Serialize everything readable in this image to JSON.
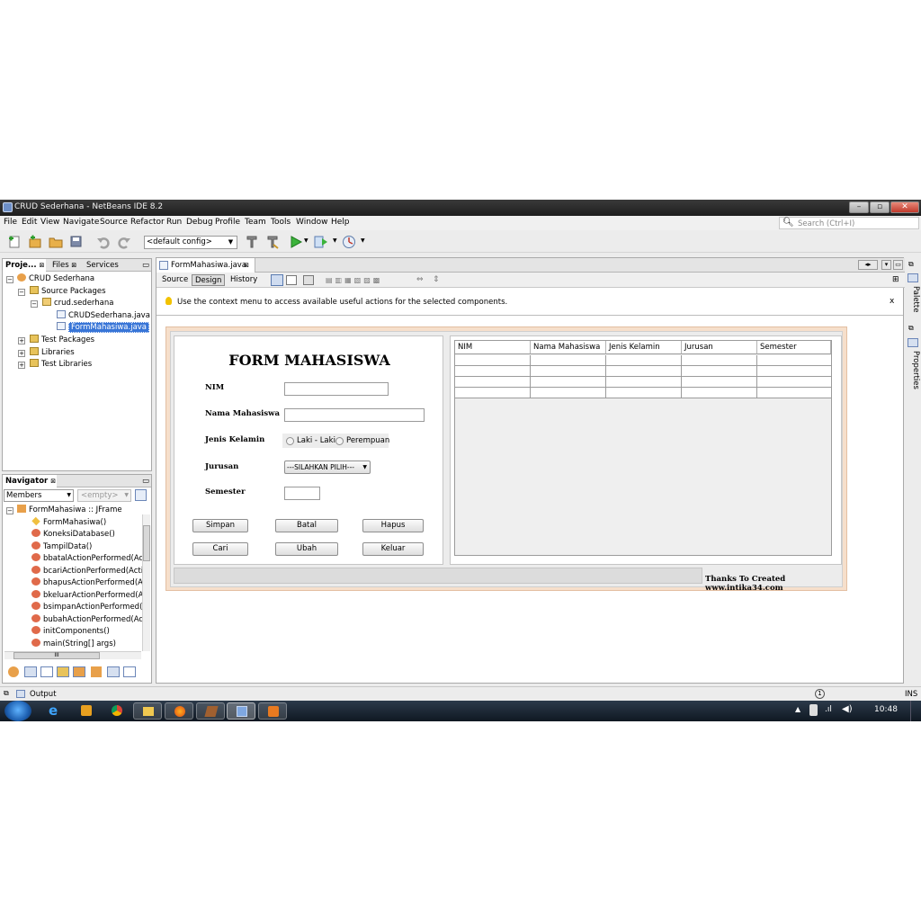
{
  "window": {
    "title": "CRUD Sederhana - NetBeans IDE 8.2"
  },
  "menu": [
    "File",
    "Edit",
    "View",
    "Navigate",
    "Source",
    "Refactor",
    "Run",
    "Debug",
    "Profile",
    "Team",
    "Tools",
    "Window",
    "Help"
  ],
  "search": {
    "placeholder": "Search (Ctrl+I)"
  },
  "toolbar": {
    "config": "<default config>"
  },
  "projects_panel": {
    "tabs": [
      "Proje...",
      "Files",
      "Services"
    ],
    "tree": [
      {
        "label": "CRUD Sederhana",
        "icon": "project-icon"
      },
      {
        "label": "Source Packages",
        "icon": "folder-icon"
      },
      {
        "label": "crud.sederhana",
        "icon": "package-icon"
      },
      {
        "label": "CRUDSederhana.java",
        "icon": "java-file-icon"
      },
      {
        "label": "FormMahasiwa.java",
        "icon": "form-file-icon",
        "selected": true
      },
      {
        "label": "Test Packages",
        "icon": "folder-icon"
      },
      {
        "label": "Libraries",
        "icon": "library-icon"
      },
      {
        "label": "Test Libraries",
        "icon": "library-icon"
      }
    ]
  },
  "navigator": {
    "title": "Navigator",
    "filter": "Members",
    "empty": "<empty>",
    "root": "FormMahasiwa :: JFrame",
    "items": [
      "FormMahasiwa()",
      "KoneksiDatabase()",
      "TampilData()",
      "bbatalActionPerformed(Action",
      "bcariActionPerformed(ActionE",
      "bhapusActionPerformed(Actio",
      "bkeluarActionPerformed(Acti",
      "bsimpanActionPerformed(Acti",
      "bubahActionPerformed(Action",
      "initComponents()",
      "main(String[] args)"
    ],
    "scroll_label": "III"
  },
  "editor": {
    "tab": "FormMahasiwa.java",
    "views": [
      "Source",
      "Design",
      "History"
    ],
    "hint": "Use the context menu to access available useful actions for the selected components.",
    "hint_close": "x"
  },
  "form": {
    "title": "FORM MAHASISWA",
    "labels": {
      "nim": "NIM",
      "nama": "Nama Mahasiswa",
      "jk": "Jenis Kelamin",
      "jurusan": "Jurusan",
      "semester": "Semester"
    },
    "radio": [
      "Laki - Laki",
      "Perempuan"
    ],
    "jurusan_value": "---SILAHKAN PILIH---",
    "buttons": [
      "Simpan",
      "Batal",
      "Hapus",
      "Cari",
      "Ubah",
      "Keluar"
    ],
    "table_headers": [
      "NIM",
      "Nama Mahasiswa",
      "Jenis Kelamin",
      "Jurusan",
      "Semester"
    ],
    "footer": "Thanks To Created www.intika34.com"
  },
  "side_tabs": [
    "Palette",
    "Properties"
  ],
  "output": {
    "label": "Output"
  },
  "status": {
    "mode": "INS",
    "notif": "1"
  },
  "clock": "10:48"
}
